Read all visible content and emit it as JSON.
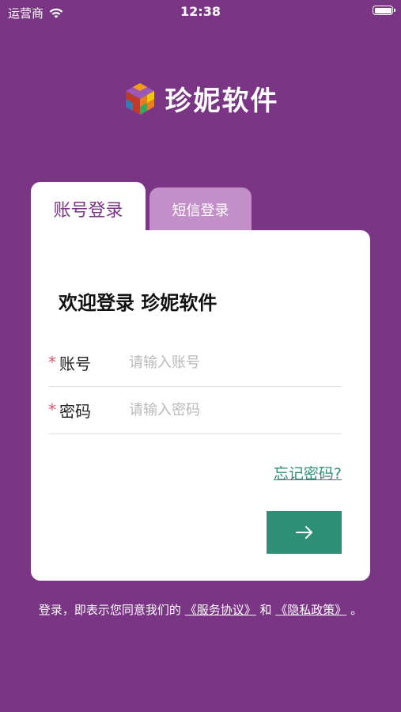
{
  "status_bar": {
    "carrier": "运营商",
    "time": "12:38",
    "battery_level": 1.0
  },
  "brand": {
    "app_name": "珍妮软件",
    "logo_icon": "cube-logo-icon"
  },
  "tabs": [
    {
      "label": "账号登录",
      "active": true
    },
    {
      "label": "短信登录",
      "active": false
    }
  ],
  "form": {
    "welcome": "欢迎登录 珍妮软件",
    "account": {
      "required_mark": "*",
      "label": "账号",
      "placeholder": "请输入账号",
      "value": ""
    },
    "password": {
      "required_mark": "*",
      "label": "密码",
      "placeholder": "请输入密码",
      "value": ""
    },
    "forgot_link": "忘记密码?",
    "submit_icon": "arrow-right-icon"
  },
  "agreement": {
    "prefix": "登录，即表示您同意我们的",
    "service_link": "《服务协议》",
    "connector": "和",
    "privacy_link": "《隐私政策》",
    "suffix": "。"
  },
  "colors": {
    "background": "#7a3585",
    "accent": "#2e8f76",
    "inactive_tab": "#c28fc8",
    "required": "#e0556a"
  }
}
